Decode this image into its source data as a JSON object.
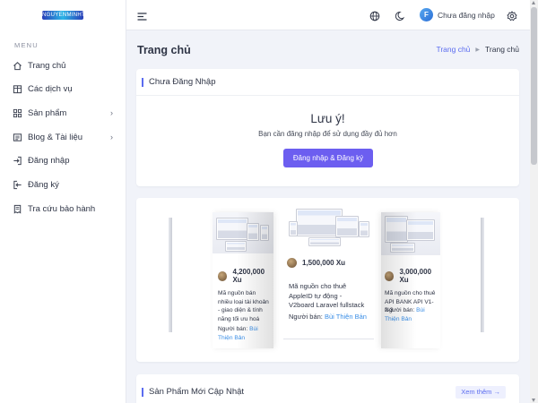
{
  "logo": {
    "text": "NGUYENMINHTAM"
  },
  "sidebar": {
    "heading": "MENU",
    "items": [
      {
        "label": "Trang chủ",
        "icon": "home-icon",
        "has_submenu": false
      },
      {
        "label": "Các dịch vụ",
        "icon": "services-icon",
        "has_submenu": false
      },
      {
        "label": "Sản phẩm",
        "icon": "grid-icon",
        "has_submenu": true
      },
      {
        "label": "Blog & Tài liệu",
        "icon": "document-icon",
        "has_submenu": true
      },
      {
        "label": "Đăng nhập",
        "icon": "login-icon",
        "has_submenu": false
      },
      {
        "label": "Đăng ký",
        "icon": "register-icon",
        "has_submenu": false
      },
      {
        "label": "Tra cứu bảo hành",
        "icon": "receipt-icon",
        "has_submenu": false
      }
    ]
  },
  "topbar": {
    "user_label": "Chưa đăng nhập",
    "user_initial": "F",
    "icons": [
      "menu-icon",
      "language-icon",
      "dark-mode-icon",
      "settings-icon"
    ]
  },
  "page": {
    "title": "Trang chủ",
    "breadcrumb": {
      "link": "Trang chủ",
      "current": "Trang chủ"
    }
  },
  "login_card": {
    "title": "Chưa Đăng Nhập",
    "notice_title": "Lưu ý!",
    "notice_text": "Bạn cần đăng nhập để sử dụng đầy đủ hơn",
    "button": "Đăng nhập & Đăng ký"
  },
  "products": [
    {
      "price": "4,200,000 Xu",
      "desc": "Mã nguồn bán nhiều loại tài khoản - giao diện & tính năng tối ưu hoá",
      "seller_label": "Người bán:",
      "seller": "Bùi Thiện Bản"
    },
    {
      "price": "1,500,000 Xu",
      "desc": "Mã nguồn cho thuê AppleID tự động - V2board Laravel fullstack",
      "seller_label": "Người bán:",
      "seller": "Bùi Thiện Bản"
    },
    {
      "price": "3,000,000 Xu",
      "desc": "Mã nguồn cho thuê API BANK API V1-2-3",
      "seller_label": "Người bán:",
      "seller": "Bùi Thiện Bản"
    }
  ],
  "new_products": {
    "title": "Sản Phẩm Mới Cập Nhật",
    "button": "Xem thêm →"
  },
  "colors": {
    "accent": "#6c5ef0",
    "link": "#3a8ee6",
    "background": "#f1f3f9"
  }
}
